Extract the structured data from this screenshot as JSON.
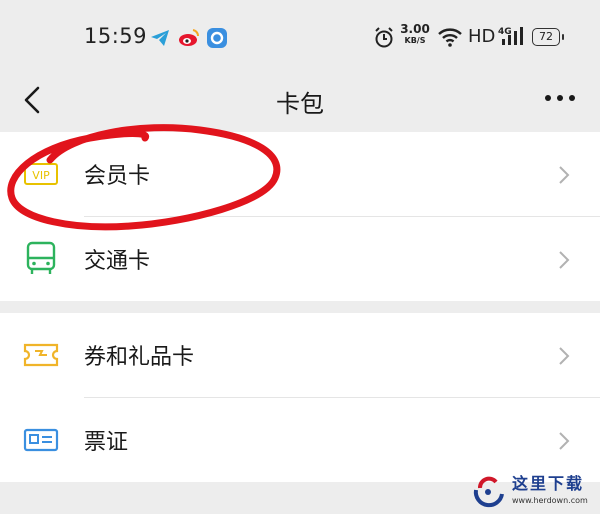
{
  "status_bar": {
    "time": "15:59",
    "notifications": [
      "telegram-icon",
      "weibo-icon",
      "app-circle-icon"
    ],
    "net_speed_value": "3.00",
    "net_speed_unit": "KB/S",
    "hd_label": "HD",
    "network": "4G",
    "battery": "72"
  },
  "header": {
    "title": "卡包"
  },
  "groups": [
    {
      "items": [
        {
          "label": "会员卡",
          "icon": "vip-card-icon",
          "icon_color": "#e8c200"
        },
        {
          "label": "交通卡",
          "icon": "bus-icon",
          "icon_color": "#2db35d"
        }
      ]
    },
    {
      "items": [
        {
          "label": "券和礼品卡",
          "icon": "ticket-icon",
          "icon_color": "#f0b429"
        },
        {
          "label": "票证",
          "icon": "id-card-icon",
          "icon_color": "#3a8fe0"
        }
      ]
    }
  ],
  "annotation": {
    "color": "#e1141c"
  },
  "watermark": {
    "brand": "这里下载",
    "url": "www.herdown.com"
  }
}
